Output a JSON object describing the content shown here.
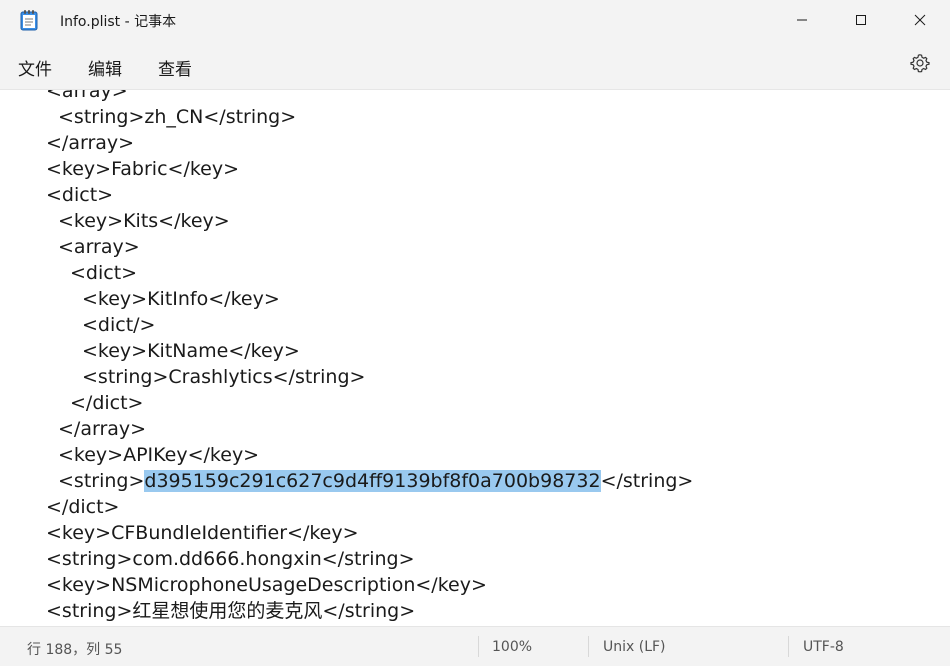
{
  "window": {
    "title": "Info.plist - 记事本",
    "app_icon": "notepad-icon",
    "controls": [
      "minimize-icon",
      "maximize-icon",
      "close-icon"
    ]
  },
  "menu": {
    "items": [
      "文件",
      "编辑",
      "查看"
    ],
    "settings_icon": "gear-icon"
  },
  "editor": {
    "lines": [
      {
        "indent": "",
        "text": "<array>"
      },
      {
        "indent": " ",
        "text": "<string>zh_CN</string>"
      },
      {
        "indent": "",
        "text": "</array>"
      },
      {
        "indent": "",
        "text": "<key>Fabric</key>"
      },
      {
        "indent": "",
        "text": "<dict>"
      },
      {
        "indent": " ",
        "text": "<key>Kits</key>"
      },
      {
        "indent": " ",
        "text": "<array>"
      },
      {
        "indent": "  ",
        "text": "<dict>"
      },
      {
        "indent": "   ",
        "text": "<key>KitInfo</key>"
      },
      {
        "indent": "   ",
        "text": "<dict/>"
      },
      {
        "indent": "   ",
        "text": "<key>KitName</key>"
      },
      {
        "indent": "   ",
        "text": "<string>Crashlytics</string>"
      },
      {
        "indent": "  ",
        "text": "</dict>"
      },
      {
        "indent": " ",
        "text": "</array>"
      },
      {
        "indent": " ",
        "text": "<key>APIKey</key>"
      },
      {
        "indent": " ",
        "text": "<string>d395159c291c627c9d4ff9139bf8f0a700b98732</string>",
        "selection": {
          "before": "<string>",
          "selected": "d395159c291c627c9d4ff9139bf8f0a700b98732",
          "after": "</string>"
        }
      },
      {
        "indent": "",
        "text": "</dict>"
      },
      {
        "indent": "",
        "text": "<key>CFBundleIdentifier</key>"
      },
      {
        "indent": "",
        "text": "<string>com.dd666.hongxin</string>"
      },
      {
        "indent": "",
        "text": "<key>NSMicrophoneUsageDescription</key>"
      },
      {
        "indent": "",
        "text": "<string>红星想使用您的麦克风</string>"
      }
    ],
    "selection_color": "#99c9ef"
  },
  "status": {
    "position": "行 188，列 55",
    "zoom": "100%",
    "line_ending": "Unix (LF)",
    "encoding": "UTF-8"
  }
}
